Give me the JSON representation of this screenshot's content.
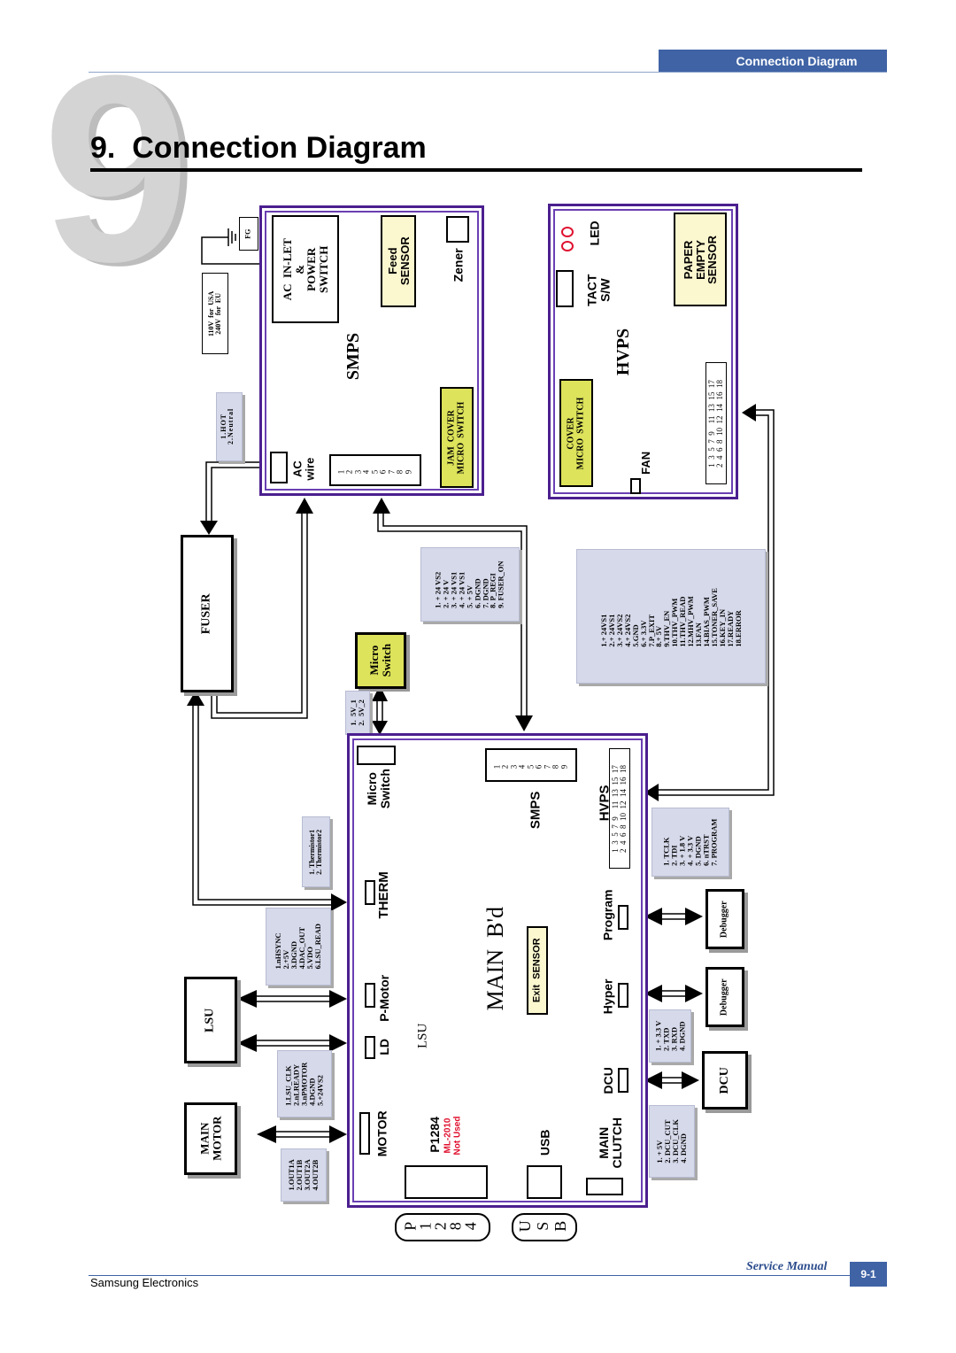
{
  "header": {
    "tab_label": "Connection Diagram",
    "chapter_number": "9",
    "title": "9.  Connection Diagram"
  },
  "footer": {
    "company": "Samsung Electronics",
    "manual": "Service Manual",
    "page": "9-1"
  },
  "colors": {
    "brand_blue": "#3f63a5",
    "board_purple": "#4b1f8f",
    "pin_box": "#d6d9ea",
    "yellow_part": "#dde35a",
    "cream_part": "#fbf7cf",
    "note_red": "#e0102e"
  },
  "smps_board": {
    "title": "SMPS",
    "ac_inlet": "AC  IN-LET\n&\nPOWER\nSWITCH",
    "feed_sensor": "Feed\nSENSOR",
    "zener": "Zener",
    "jam_cover": "JAM  COVER\nMICRO  SWITCH",
    "ac_wire": "AC\nwire",
    "connector_pins": "1\n2\n3\n4\n5\n6\n7\n8\n9",
    "fg": "FG",
    "voltage_note": "110V  for  USA\n240V  for  EU",
    "ac_pins": "1.HOT\n2.Neutral"
  },
  "hvps_board": {
    "title": "HVPS",
    "led": "LED",
    "tact": "TACT\nS/W",
    "paper_empty": "PAPER\nEMPTY\nSENSOR",
    "cover_switch": "COVER\nMICRO  SWITCH",
    "fan": "FAN",
    "connector_pins": "1  3  5  7  9    11  13  15  17\n2  4  6  8  10  12  14  16  18"
  },
  "fuser": {
    "label": "FUSER"
  },
  "micro_switch_part": {
    "label": "Micro\nSwitch",
    "pins": "1.  5V_1\n2.  5V_2"
  },
  "smps_harness_pins": "1. + 24 VS2\n2. + 24 V\n3. + 24 VS1\n4. + 24 VS1\n5. + 5V\n6. DGND\n7. DGND\n8. P_REGI\n9. FUSER_ON",
  "hvps_harness_pins": "1.+ 24VS1\n2.+ 24VS1\n3.+ 24VS2\n4.+ 24VS2\n5.GND\n6.+ 3.3V\n7.P_EXIT\n8.+ 5V\n9.THV_EN\n10.THV_PWM\n11.THV_READ\n12.MHV_PWM\n13.FAN\n14.BIAS_PWM\n15.TONER_SAVE\n16.KEY_IN\n17.READY\n18.ERROR",
  "main_board": {
    "title": "MAIN  B'd",
    "micro_switch": "Micro\nSwitch",
    "smps": "SMPS",
    "smps_pins": "1\n2\n3\n4\n5\n6\n7\n8\n9",
    "hvps": "HVPS",
    "hvps_pins": "1  3  5  7  9    11  13  15  17\n2  4  6  8  10  12  14  16  18",
    "therm": "THERM",
    "program": "Program",
    "p_motor": "P-Motor",
    "ld": "LD",
    "lsu": "LSU",
    "exit_sensor": "Exit  SENSOR",
    "hyper": "Hyper",
    "dcu": "DCU",
    "motor": "MOTOR",
    "p1284": "P1284",
    "p1284_note": "ML-2010\nNot Used",
    "usb": "USB",
    "main_clutch": "MAIN\nCLUTCH"
  },
  "thermistor_pins": "1. Thermistor1\n2. Thermistor2",
  "lsu_pins_a": "1.nHSYNC\n2.+5V\n3.DGND\n4.DAC_OUT\n5.VDO\n6.LSU_READ",
  "lsu_pins_b": "1.LSU_CLK\n2.nLREADY\n3.nPMOTOR\n4.DGND\n5.+24VS2",
  "motor_pins": "1.OUT1A\n2.OUT1B\n3.OUT2A\n4.OUT2B",
  "program_pins": "1. TCLK\n2. TDI\n3. + 1.8 V\n4. + 3.3 V\n5. DGND\n6. nTRST\n7. PROGRAM",
  "hyper_pins": "1. + 3.3 V\n2. TXD\n3. RXD\n4. DGND",
  "dcu_pins": "1. + 5V\n2. DCU_CUT\n3. DCU_CLK\n4. DGND",
  "external": {
    "lsu": "LSU",
    "main_motor": "MAIN\nMOTOR",
    "debugger_program": "Debugger",
    "debugger_hyper": "Debugger",
    "dcu": "DCU",
    "port_p1284": "P\n1\n2\n8\n4",
    "port_usb": "U\nS\nB"
  }
}
